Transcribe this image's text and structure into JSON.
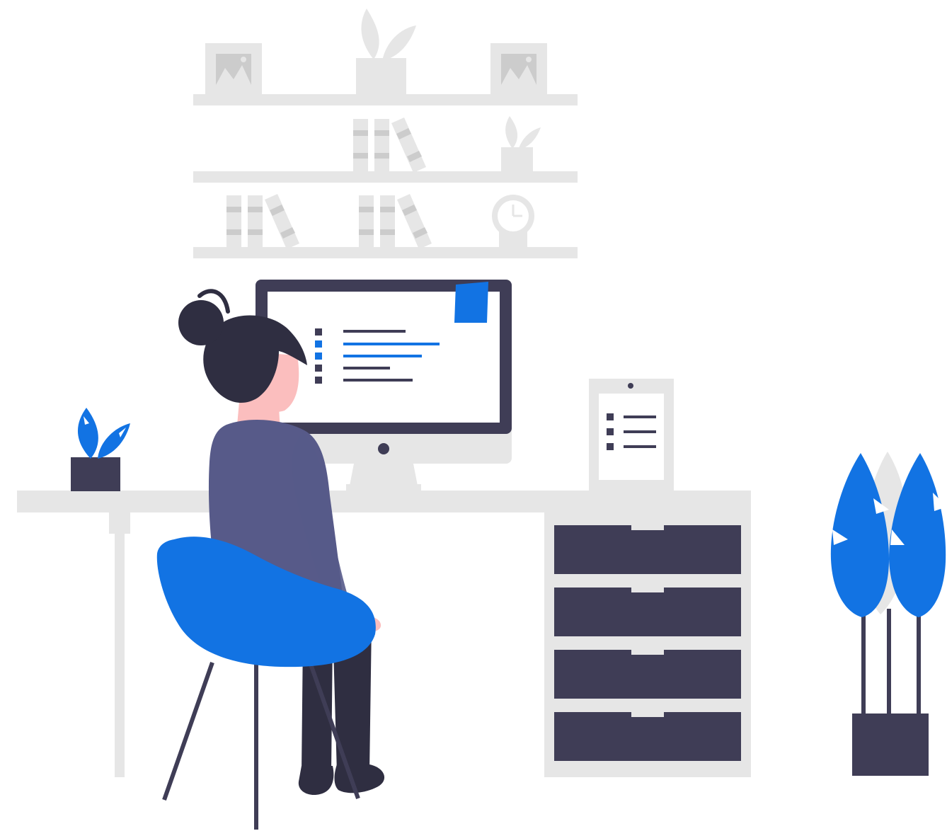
{
  "illustration": {
    "subject": "woman-working-at-desk",
    "colors": {
      "accent": "#1273e3",
      "dark": "#3f3d56",
      "hair": "#2f2e41",
      "sweater": "#575a89",
      "skin": "#fbbebe",
      "furniture": "#e6e6e6",
      "paper": "#f2f2f2",
      "background": "#ffffff"
    },
    "icons": [
      "shelf-icon",
      "picture-frame-icon",
      "plant-icon",
      "book-icon",
      "clock-icon",
      "monitor-icon",
      "sticky-note-icon",
      "document-icon",
      "drawer-icon",
      "chair-icon",
      "person-icon"
    ],
    "screen_list_rows": 5,
    "document_list_rows": 3,
    "drawer_count": 4
  }
}
